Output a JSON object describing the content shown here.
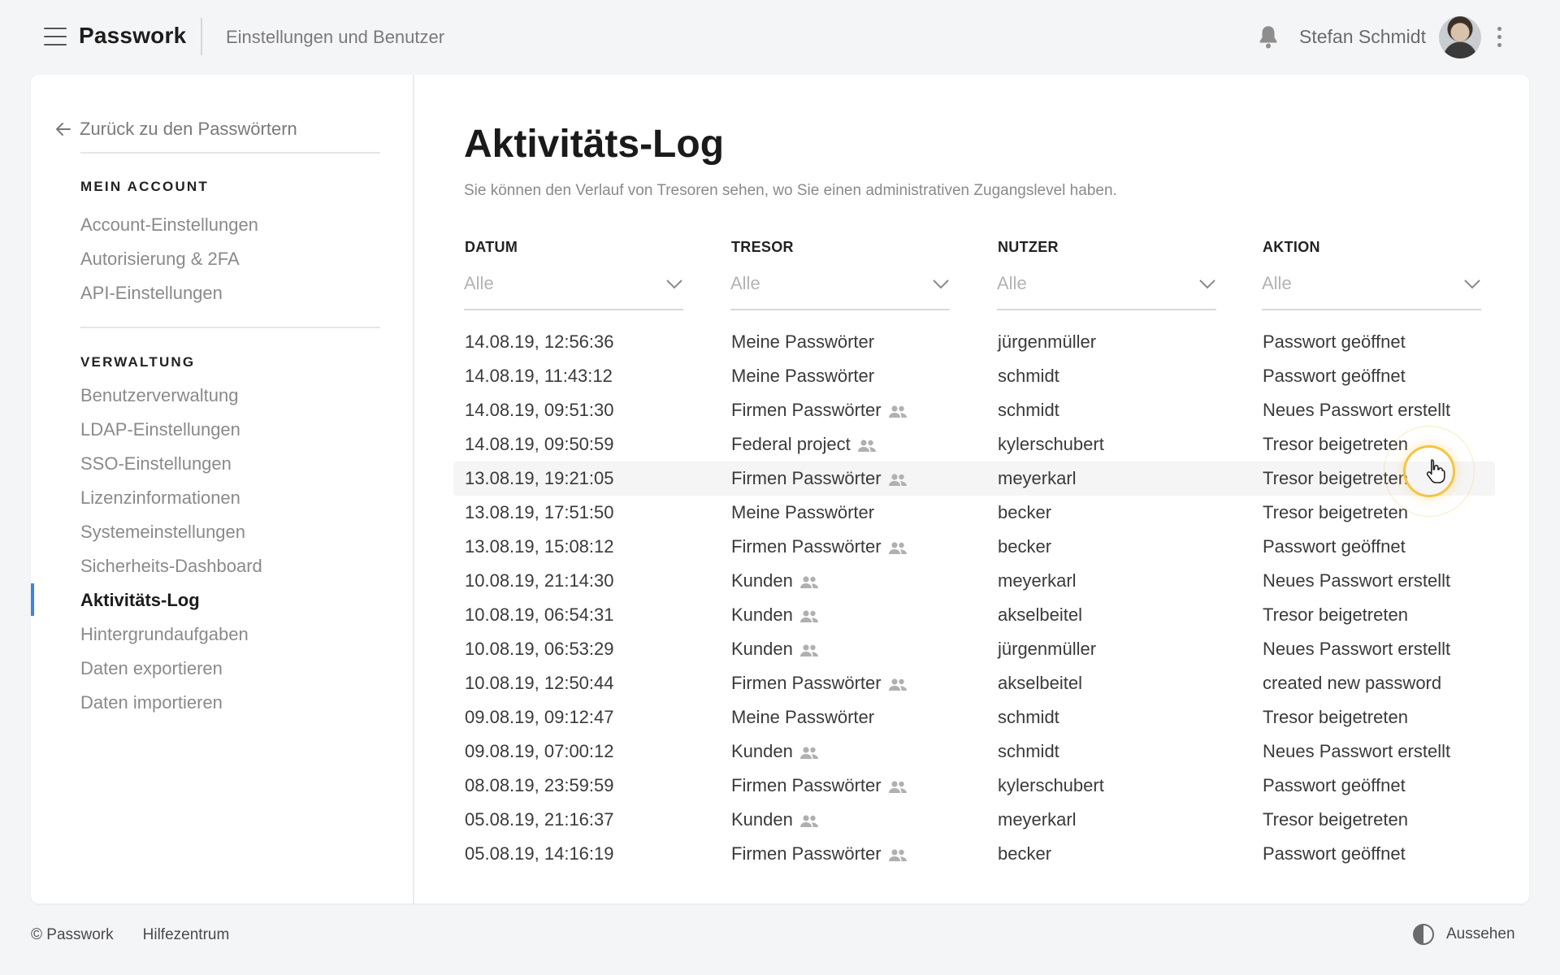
{
  "header": {
    "brand": "Passwork",
    "section": "Einstellungen und Benutzer",
    "username": "Stefan Schmidt"
  },
  "sidebar": {
    "back_label": "Zurück zu den Passwörtern",
    "group_account": "MEIN ACCOUNT",
    "account_items": [
      "Account-Einstellungen",
      "Autorisierung & 2FA",
      "API-Einstellungen"
    ],
    "group_admin": "VERWALTUNG",
    "admin_items": [
      "Benutzerverwaltung",
      "LDAP-Einstellungen",
      "SSO-Einstellungen",
      "Lizenzinformationen",
      "Systemeinstellungen",
      "Sicherheits-Dashboard",
      "Aktivitäts-Log",
      "Hintergrundaufgaben",
      "Daten exportieren",
      "Daten importieren"
    ],
    "active_item": "Aktivitäts-Log"
  },
  "main": {
    "title": "Aktivitäts-Log",
    "description": "Sie können den Verlauf von Tresoren sehen, wo Sie einen administrativen Zugangslevel haben.",
    "columns": [
      "DATUM",
      "TRESOR",
      "NUTZER",
      "AKTION"
    ],
    "filter_placeholder": "Alle",
    "rows": [
      {
        "date": "14.08.19, 12:56:36",
        "vault": "Meine Passwörter",
        "shared": false,
        "user": "jürgenmüller",
        "action": "Passwort geöffnet"
      },
      {
        "date": "14.08.19, 11:43:12",
        "vault": "Meine Passwörter",
        "shared": false,
        "user": "schmidt",
        "action": "Passwort geöffnet"
      },
      {
        "date": "14.08.19, 09:51:30",
        "vault": "Firmen Passwörter",
        "shared": true,
        "user": "schmidt",
        "action": "Neues Passwort erstellt"
      },
      {
        "date": "14.08.19, 09:50:59",
        "vault": "Federal project",
        "shared": true,
        "user": "kylerschubert",
        "action": "Tresor beigetreten"
      },
      {
        "date": "13.08.19, 19:21:05",
        "vault": "Firmen Passwörter",
        "shared": true,
        "user": "meyerkarl",
        "action": "Tresor beigetreten"
      },
      {
        "date": "13.08.19, 17:51:50",
        "vault": "Meine Passwörter",
        "shared": false,
        "user": "becker",
        "action": "Tresor beigetreten"
      },
      {
        "date": "13.08.19, 15:08:12",
        "vault": "Firmen Passwörter",
        "shared": true,
        "user": "becker",
        "action": "Passwort geöffnet"
      },
      {
        "date": "10.08.19, 21:14:30",
        "vault": "Kunden",
        "shared": true,
        "user": "meyerkarl",
        "action": "Neues Passwort erstellt"
      },
      {
        "date": "10.08.19, 06:54:31",
        "vault": "Kunden",
        "shared": true,
        "user": "akselbeitel",
        "action": "Tresor beigetreten"
      },
      {
        "date": "10.08.19, 06:53:29",
        "vault": "Kunden",
        "shared": true,
        "user": "jürgenmüller",
        "action": "Neues Passwort erstellt"
      },
      {
        "date": "10.08.19, 12:50:44",
        "vault": "Firmen Passwörter",
        "shared": true,
        "user": "akselbeitel",
        "action": "created new password"
      },
      {
        "date": "09.08.19, 09:12:47",
        "vault": "Meine Passwörter",
        "shared": false,
        "user": "schmidt",
        "action": "Tresor beigetreten"
      },
      {
        "date": "09.08.19, 07:00:12",
        "vault": "Kunden",
        "shared": true,
        "user": "schmidt",
        "action": "Neues Passwort erstellt"
      },
      {
        "date": "08.08.19, 23:59:59",
        "vault": "Firmen Passwörter",
        "shared": true,
        "user": "kylerschubert",
        "action": "Passwort geöffnet"
      },
      {
        "date": "05.08.19, 21:16:37",
        "vault": "Kunden",
        "shared": true,
        "user": "meyerkarl",
        "action": "Tresor beigetreten"
      },
      {
        "date": "05.08.19, 14:16:19",
        "vault": "Firmen Passwörter",
        "shared": true,
        "user": "becker",
        "action": "Passwort geöffnet"
      }
    ]
  },
  "footer": {
    "copyright": "© Passwork",
    "help": "Hilfezentrum",
    "appearance": "Aussehen"
  },
  "colors": {
    "accent": "#3b82f6",
    "cursor_highlight": "#f4c542"
  },
  "icons": [
    "menu-icon",
    "bell-icon",
    "more-vertical-icon",
    "arrow-left-icon",
    "chevron-down-icon",
    "shared-users-icon",
    "contrast-icon",
    "hand-cursor-icon"
  ]
}
